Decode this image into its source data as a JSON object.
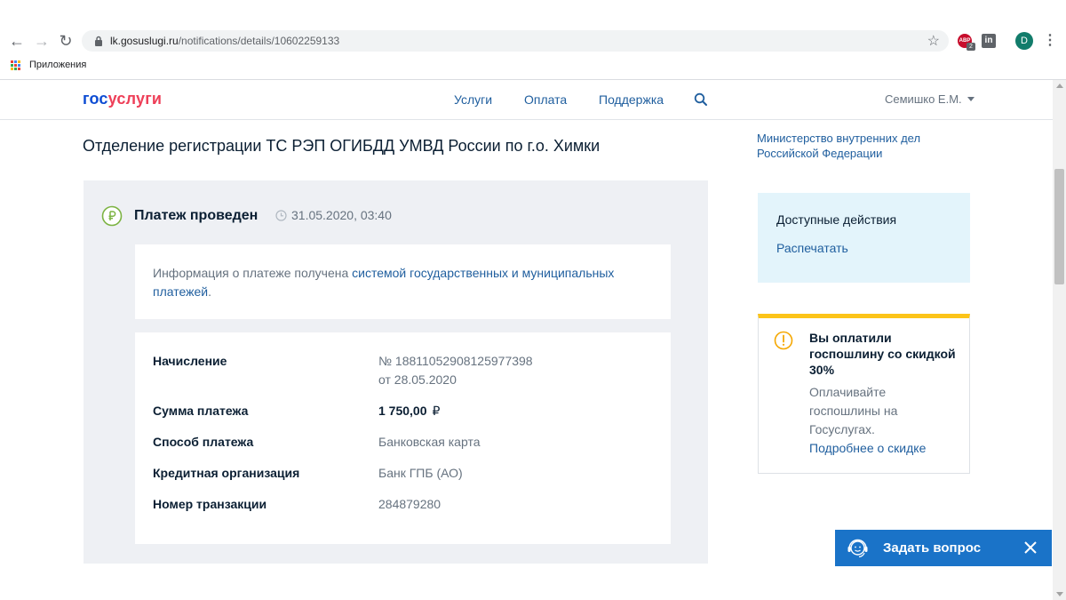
{
  "browser": {
    "url_host": "lk.gosuslugi.ru",
    "url_path": "/notifications/details/10602259133",
    "extension_abp_label": "ABP",
    "extension_abp_badge": "2",
    "extension_linkedin_label": "in",
    "profile_initial": "D",
    "bookmarks_apps_label": "Приложения"
  },
  "header": {
    "logo_part1": "гос",
    "logo_part2": "услуги",
    "nav": [
      {
        "label": "Услуги"
      },
      {
        "label": "Оплата"
      },
      {
        "label": "Поддержка"
      }
    ],
    "user_name": "Семишко Е.М."
  },
  "main": {
    "title": "Отделение регистрации ТС РЭП ОГИБДД УМВД России по г.о. Химки",
    "status": {
      "label": "Платеж проведен",
      "datetime": "31.05.2020, 03:40"
    },
    "info": {
      "text_before": "Информация о платеже получена ",
      "link_text": "системой государственных и муниципальных платежей",
      "text_after": "."
    },
    "details": {
      "accrual_label": "Начисление",
      "accrual_number": "№ 18811052908125977398",
      "accrual_date": "от 28.05.2020",
      "amount_label": "Сумма платежа",
      "amount_value": "1 750,00",
      "currency_sign": "₽",
      "method_label": "Способ платежа",
      "method_value": "Банковская карта",
      "bank_label": "Кредитная организация",
      "bank_value": "Банк ГПБ (АО)",
      "transaction_label": "Номер транзакции",
      "transaction_value": "284879280"
    }
  },
  "sidebar": {
    "ministry": "Министерство внутренних дел Российской Федерации",
    "actions_title": "Доступные действия",
    "print_link": "Распечатать",
    "discount_title": "Вы оплатили госпошлину со скидкой 30%",
    "discount_text": "Оплачивайте госпошлины на Госуслугах.",
    "discount_link": "Подробнее о скидке"
  },
  "chat": {
    "label": "Задать вопрос"
  },
  "colors": {
    "brand_blue": "#0d4cd3",
    "brand_red": "#ee3f58",
    "link": "#1f5e9e",
    "success": "#7cb342",
    "warning": "#fcc419",
    "chat_bg": "#1a73c8"
  }
}
